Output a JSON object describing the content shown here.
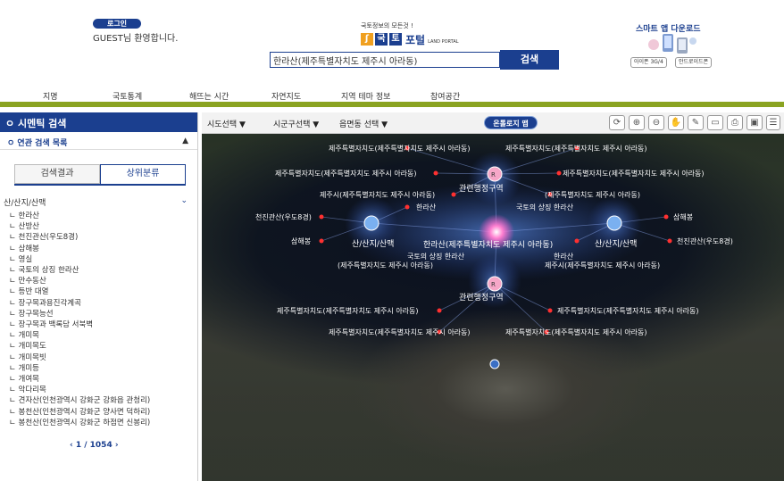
{
  "header": {
    "login_label": "로그인",
    "greeting": "GUEST님 환영합니다.",
    "slogan": "국토정보의 모든것 !",
    "logo_chars": [
      "국",
      "토"
    ],
    "logo_text": "포털",
    "logo_sub": "LAND PORTAL",
    "search_value": "한라산(제주특별자치도 제주시 아라동)",
    "search_label": "검색",
    "app_title": "스마트 앱 다운로드",
    "app_btn_ios": "아이폰 3G/4",
    "app_btn_android": "안드로이드폰"
  },
  "nav": [
    "지명",
    "국토통계",
    "해뜨는 시간",
    "자연지도",
    "지역 테마 정보",
    "참여공간"
  ],
  "sidebar": {
    "title": "ㅇ 시멘틱 검색",
    "related_title": "ㅇ 연관 검색 목록",
    "related_toggle": "▲",
    "tab_results": "검색결과",
    "tab_category": "상위분류",
    "category_header": "산/산지/산맥",
    "category_chevron": "⌄",
    "items": [
      "ㄴ 한라산",
      "ㄴ 산방산",
      "ㄴ 천진관산(우도8경)",
      "ㄴ 삼해봉",
      "ㄴ 영실",
      "ㄴ 국토의 상징 한라산",
      "ㄴ 만수동산",
      "ㄴ 등반 대열",
      "ㄴ 장구목과용진각계곡",
      "ㄴ 장구목능선",
      "ㄴ 장구목과 백록담 서북벽",
      "ㄴ 개미목",
      "ㄴ 개미목도",
      "ㄴ 개미목빗",
      "ㄴ 개미등",
      "ㄴ 개여목",
      "ㄴ 악다리목",
      "ㄴ 견자산(인천광역시 강화군 강화읍 관청리)",
      "ㄴ 봉천산(인천광역시 강화군 양사면 덕하리)",
      "ㄴ 봉천산(인천광역시 강화군 하점면 신봉리)"
    ],
    "pager": "‹    1 / 1054    ›"
  },
  "map_toolbar": {
    "sido": "시도선택  ▼",
    "sigungu": "시군구선택  ▼",
    "eupmyeon": "읍면동 선택 ▼",
    "ontology": "온톨로지 맵",
    "tools": [
      "⟳",
      "⊕",
      "⊖",
      "✋",
      "✎",
      "▭",
      "⎙",
      "▣",
      "☰"
    ]
  },
  "graph": {
    "center": "한라산(제주특별자치도 제주시 아라동)",
    "hub_top": "관련행정구역",
    "hub_left": "산/산지/산맥",
    "hub_right": "산/산지/산맥",
    "hub_bottom": "관련행정구역",
    "labels": {
      "t1": "제주특별자치도(제주특별자치도 제주시 아라동)",
      "t2": "제주특별자치도(제주특별자치도 제주시 아라동)",
      "t3": "제주특별자치도(제주특별자치도 제주시 아라동)",
      "t4": "제주특별자치도(제주특별자치도 제주시 아라동)",
      "t5": "제주시(제주특별자치도 제주시 아라동)",
      "t6": "(제주특별자치도 제주시 아라동)",
      "l1": "천진관산(우도8경)",
      "l2": "삼해봉",
      "l3": "한라산",
      "l4": "국토의 상징 한라산",
      "l5": "국토의 상징 한라산",
      "r1": "삼해봉",
      "r2": "천진관산(우도8경)",
      "r3": "한라산",
      "m1": "(제주특별자치도 제주시 아라동)",
      "m2": "제주시(제주특별자치도 제주시 아라동)",
      "b1": "제주특별자치도(제주특별자치도 제주시 아라동)",
      "b2": "제주특별자치도(제주특별자치도 제주시 아라동)",
      "b3": "제주특별자치도(제주특별자치도 제주시 아라동)",
      "b4": "제주특별자치도(제주특별자치도 제주시 아라동)"
    }
  }
}
